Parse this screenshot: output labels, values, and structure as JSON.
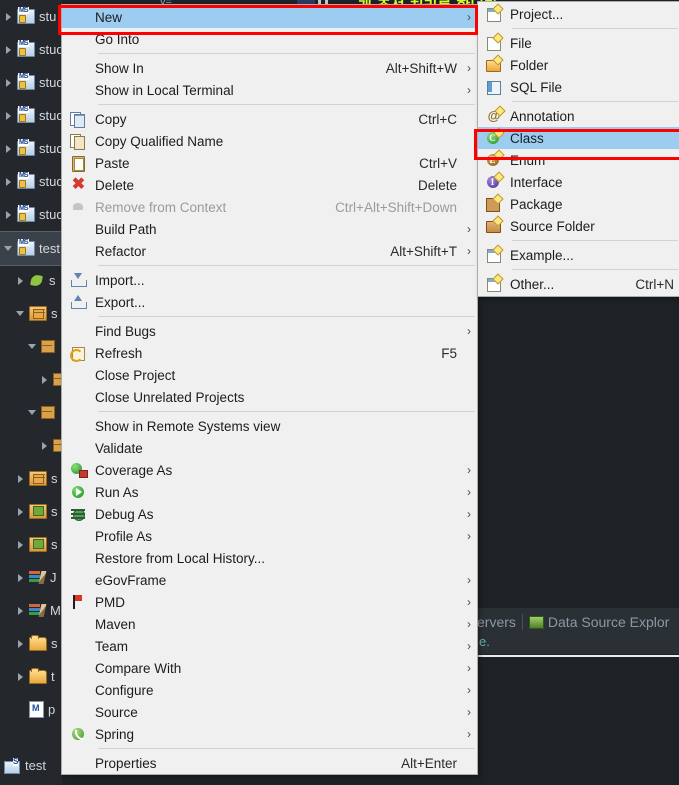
{
  "window": {
    "top_code_text": "개 주석 처리를 합니다",
    "top_code_snippet": "y="
  },
  "project_explorer": {
    "items": [
      {
        "label": "stu",
        "icon": "java-project-icon",
        "expanded": false,
        "indent": 0
      },
      {
        "label": "stud",
        "icon": "java-project-icon",
        "expanded": false,
        "indent": 0
      },
      {
        "label": "stud",
        "icon": "java-project-icon",
        "expanded": false,
        "indent": 0
      },
      {
        "label": "stud",
        "icon": "java-project-icon",
        "expanded": false,
        "indent": 0
      },
      {
        "label": "stud",
        "icon": "java-project-icon",
        "expanded": false,
        "indent": 0
      },
      {
        "label": "stud",
        "icon": "java-project-icon",
        "expanded": false,
        "indent": 0
      },
      {
        "label": "stud",
        "icon": "java-project-icon",
        "expanded": false,
        "indent": 0
      },
      {
        "label": "test",
        "icon": "java-project-icon",
        "expanded": true,
        "indent": 0,
        "selected": true
      },
      {
        "label": "s",
        "icon": "deployment-descriptor-icon",
        "expanded": false,
        "indent": 1
      },
      {
        "label": "s",
        "icon": "source-package-icon",
        "expanded": true,
        "indent": 1
      },
      {
        "label": "",
        "icon": "package-icon",
        "expanded": true,
        "indent": 2
      },
      {
        "label": "",
        "icon": "package-child-icon",
        "expanded": false,
        "indent": 3
      },
      {
        "label": "",
        "icon": "package-icon",
        "expanded": true,
        "indent": 2
      },
      {
        "label": "",
        "icon": "package-child-icon",
        "expanded": false,
        "indent": 3
      },
      {
        "label": "s",
        "icon": "source-package-icon",
        "expanded": false,
        "indent": 1
      },
      {
        "label": "s",
        "icon": "resource-package-icon",
        "expanded": false,
        "indent": 1
      },
      {
        "label": "s",
        "icon": "resource-package-icon",
        "expanded": false,
        "indent": 1
      },
      {
        "label": "J",
        "icon": "library-icon",
        "expanded": false,
        "indent": 1
      },
      {
        "label": "M",
        "icon": "library-icon",
        "expanded": false,
        "indent": 1
      },
      {
        "label": "s",
        "icon": "folder-icon",
        "expanded": false,
        "indent": 1
      },
      {
        "label": "t",
        "icon": "folder-icon",
        "expanded": false,
        "indent": 1
      },
      {
        "label": "p",
        "icon": "maven-pom-icon",
        "expanded": null,
        "indent": 1
      }
    ]
  },
  "context_menu": {
    "items": [
      {
        "label": "New",
        "accel": "",
        "icon": "",
        "submenu": true,
        "highlighted": true,
        "disabled": false
      },
      {
        "label": "Go Into",
        "accel": "",
        "icon": "",
        "submenu": false,
        "highlighted": false,
        "disabled": false
      },
      {
        "separator": true
      },
      {
        "label": "Show In",
        "accel": "Alt+Shift+W",
        "icon": "",
        "submenu": true,
        "highlighted": false,
        "disabled": false
      },
      {
        "label": "Show in Local Terminal",
        "accel": "",
        "icon": "",
        "submenu": true,
        "highlighted": false,
        "disabled": false
      },
      {
        "separator": true
      },
      {
        "label": "Copy",
        "accel": "Ctrl+C",
        "icon": "copy-icon",
        "submenu": false,
        "highlighted": false,
        "disabled": false
      },
      {
        "label": "Copy Qualified Name",
        "accel": "",
        "icon": "copy-qualified-name-icon",
        "submenu": false,
        "highlighted": false,
        "disabled": false
      },
      {
        "label": "Paste",
        "accel": "Ctrl+V",
        "icon": "paste-icon",
        "submenu": false,
        "highlighted": false,
        "disabled": false
      },
      {
        "label": "Delete",
        "accel": "Delete",
        "icon": "delete-icon",
        "submenu": false,
        "highlighted": false,
        "disabled": false
      },
      {
        "label": "Remove from Context",
        "accel": "Ctrl+Alt+Shift+Down",
        "icon": "remove-from-context-icon",
        "submenu": false,
        "highlighted": false,
        "disabled": true
      },
      {
        "label": "Build Path",
        "accel": "",
        "icon": "",
        "submenu": true,
        "highlighted": false,
        "disabled": false
      },
      {
        "label": "Refactor",
        "accel": "Alt+Shift+T",
        "icon": "",
        "submenu": true,
        "highlighted": false,
        "disabled": false
      },
      {
        "separator": true
      },
      {
        "label": "Import...",
        "accel": "",
        "icon": "import-icon",
        "submenu": false,
        "highlighted": false,
        "disabled": false
      },
      {
        "label": "Export...",
        "accel": "",
        "icon": "export-icon",
        "submenu": false,
        "highlighted": false,
        "disabled": false
      },
      {
        "separator": true
      },
      {
        "label": "Find Bugs",
        "accel": "",
        "icon": "",
        "submenu": true,
        "highlighted": false,
        "disabled": false
      },
      {
        "label": "Refresh",
        "accel": "F5",
        "icon": "refresh-icon",
        "submenu": false,
        "highlighted": false,
        "disabled": false
      },
      {
        "label": "Close Project",
        "accel": "",
        "icon": "",
        "submenu": false,
        "highlighted": false,
        "disabled": false
      },
      {
        "label": "Close Unrelated Projects",
        "accel": "",
        "icon": "",
        "submenu": false,
        "highlighted": false,
        "disabled": false
      },
      {
        "separator": true
      },
      {
        "label": "Show in Remote Systems view",
        "accel": "",
        "icon": "",
        "submenu": false,
        "highlighted": false,
        "disabled": false
      },
      {
        "label": "Validate",
        "accel": "",
        "icon": "",
        "submenu": false,
        "highlighted": false,
        "disabled": false
      },
      {
        "label": "Coverage As",
        "accel": "",
        "icon": "coverage-icon",
        "submenu": true,
        "highlighted": false,
        "disabled": false
      },
      {
        "label": "Run As",
        "accel": "",
        "icon": "run-icon",
        "submenu": true,
        "highlighted": false,
        "disabled": false
      },
      {
        "label": "Debug As",
        "accel": "",
        "icon": "debug-bug-icon",
        "submenu": true,
        "highlighted": false,
        "disabled": false
      },
      {
        "label": "Profile As",
        "accel": "",
        "icon": "",
        "submenu": true,
        "highlighted": false,
        "disabled": false
      },
      {
        "label": "Restore from Local History...",
        "accel": "",
        "icon": "",
        "submenu": false,
        "highlighted": false,
        "disabled": false
      },
      {
        "label": "eGovFrame",
        "accel": "",
        "icon": "",
        "submenu": true,
        "highlighted": false,
        "disabled": false
      },
      {
        "label": "PMD",
        "accel": "",
        "icon": "pmd-flag-icon",
        "submenu": true,
        "highlighted": false,
        "disabled": false
      },
      {
        "label": "Maven",
        "accel": "",
        "icon": "",
        "submenu": true,
        "highlighted": false,
        "disabled": false
      },
      {
        "label": "Team",
        "accel": "",
        "icon": "",
        "submenu": true,
        "highlighted": false,
        "disabled": false
      },
      {
        "label": "Compare With",
        "accel": "",
        "icon": "",
        "submenu": true,
        "highlighted": false,
        "disabled": false
      },
      {
        "label": "Configure",
        "accel": "",
        "icon": "",
        "submenu": true,
        "highlighted": false,
        "disabled": false
      },
      {
        "label": "Source",
        "accel": "",
        "icon": "",
        "submenu": true,
        "highlighted": false,
        "disabled": false
      },
      {
        "label": "Spring",
        "accel": "",
        "icon": "spring-leaf-icon",
        "submenu": true,
        "highlighted": false,
        "disabled": false
      },
      {
        "separator": true
      },
      {
        "label": "Properties",
        "accel": "Alt+Enter",
        "icon": "",
        "submenu": false,
        "highlighted": false,
        "disabled": false
      }
    ]
  },
  "new_submenu": {
    "items": [
      {
        "label": "Project...",
        "accel": "",
        "icon": "new-project-wizard-icon",
        "highlighted": false
      },
      {
        "separator": true
      },
      {
        "label": "File",
        "accel": "",
        "icon": "new-file-icon",
        "highlighted": false
      },
      {
        "label": "Folder",
        "accel": "",
        "icon": "new-folder-icon",
        "highlighted": false
      },
      {
        "label": "SQL File",
        "accel": "",
        "icon": "new-sql-file-icon",
        "highlighted": false
      },
      {
        "separator": true
      },
      {
        "label": "Annotation",
        "accel": "",
        "icon": "new-annotation-icon",
        "highlighted": false
      },
      {
        "label": "Class",
        "accel": "",
        "icon": "new-class-icon",
        "highlighted": true
      },
      {
        "label": "Enum",
        "accel": "",
        "icon": "new-enum-icon",
        "highlighted": false
      },
      {
        "label": "Interface",
        "accel": "",
        "icon": "new-interface-icon",
        "highlighted": false
      },
      {
        "label": "Package",
        "accel": "",
        "icon": "new-package-icon",
        "highlighted": false
      },
      {
        "label": "Source Folder",
        "accel": "",
        "icon": "new-source-folder-icon",
        "highlighted": false
      },
      {
        "separator": true
      },
      {
        "label": "Example...",
        "accel": "",
        "icon": "new-example-icon",
        "highlighted": false
      },
      {
        "separator": true
      },
      {
        "label": "Other...",
        "accel": "Ctrl+N",
        "icon": "new-other-icon",
        "highlighted": false
      }
    ]
  },
  "bottom_view_tabs": {
    "tab_partial": "ervers",
    "tab_data_source": "Data Source Explor",
    "panel_text": "e."
  },
  "status_bar": {
    "label": "test"
  },
  "colors": {
    "menu_background": "#f0f0f0",
    "menu_highlight": "#9ccdf0",
    "annotation_red": "#ff0000",
    "ide_dark": "#1e2226",
    "tree_background": "#24282c",
    "tree_selected": "#3b4148",
    "korean_text": "#d7ff2f"
  }
}
